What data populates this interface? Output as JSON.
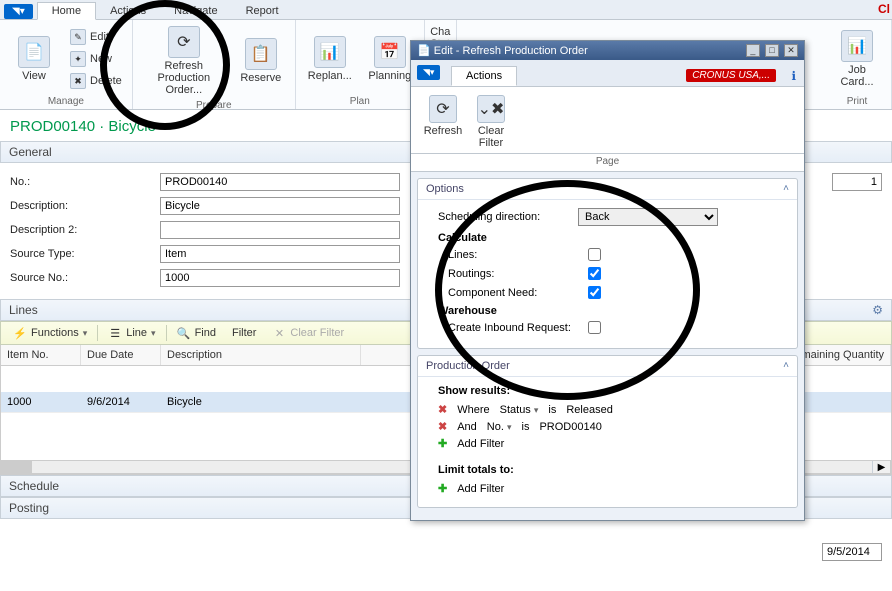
{
  "ribbon": {
    "tabs": [
      "Home",
      "Actions",
      "Navigate",
      "Report"
    ],
    "manage": {
      "view": "View",
      "edit": "Edit",
      "new": "New",
      "delete": "Delete",
      "label": "Manage"
    },
    "prepare": {
      "refresh": "Refresh Production Order...",
      "reserve": "Reserve",
      "label": "Prepare"
    },
    "plan": {
      "replan": "Replan...",
      "planning": "Planning",
      "label": "Plan"
    },
    "cha": {
      "chastat": "Cha Stat",
      "chan": "Chan"
    },
    "print": {
      "jobcard": "Job Card...",
      "label": "Print"
    }
  },
  "page": {
    "title": "PROD00140 · Bicycle"
  },
  "general": {
    "title": "General",
    "labels": {
      "no": "No.:",
      "desc": "Description:",
      "desc2": "Description 2:",
      "stype": "Source Type:",
      "sno": "Source No.:"
    },
    "values": {
      "no": "PROD00140",
      "desc": "Bicycle",
      "desc2": "",
      "stype": "Item",
      "sno": "1000",
      "right": "1"
    }
  },
  "lines": {
    "title": "Lines",
    "toolbar": {
      "functions": "Functions",
      "line": "Line",
      "find": "Find",
      "filter": "Filter",
      "clearfilter": "Clear Filter"
    },
    "cols": {
      "item": "Item No.",
      "due": "Due Date",
      "desc": "Description",
      "remain": "Remaining Quantity"
    },
    "row": {
      "item": "1000",
      "due": "9/6/2014",
      "desc": "Bicycle"
    }
  },
  "schedule": {
    "title": "Schedule",
    "date": "9/5/2014"
  },
  "posting": {
    "title": "Posting"
  },
  "dialog": {
    "title": "Edit - Refresh Production Order",
    "cronus": "CRONUS USA,...",
    "tab": "Actions",
    "refresh": "Refresh",
    "clearfilter": "Clear Filter",
    "page": "Page",
    "options": {
      "title": "Options",
      "scheddir": "Scheduling direction:",
      "scheddir_val": "Back",
      "calculate": "Calculate",
      "lines": "Lines:",
      "routings": "Routings:",
      "compneed": "Component Need:",
      "warehouse": "Warehouse",
      "inbound": "Create Inbound Request:"
    },
    "prodorder": {
      "title": "Production Order",
      "show": "Show results:",
      "where": "Where",
      "status": "Status",
      "is": "is",
      "released": "Released",
      "and": "And",
      "no": "No.",
      "prod": "PROD00140",
      "addfilter": "Add Filter",
      "limit": "Limit totals to:"
    }
  }
}
